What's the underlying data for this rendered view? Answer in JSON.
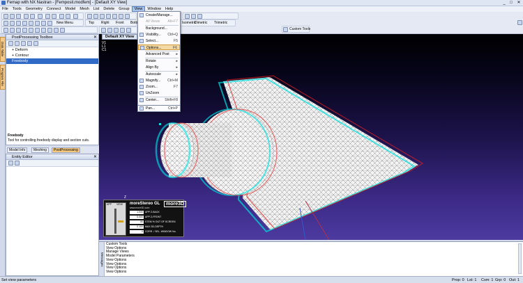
{
  "window": {
    "title": "Femap with NX Nastran - [Femposit.modfem] - [Default XY View]",
    "min": "_",
    "max": "□",
    "close": "✕"
  },
  "menubar": [
    "File",
    "Tools",
    "Geometry",
    "Connect",
    "Model",
    "Mesh",
    "List",
    "Delete",
    "Group",
    "View",
    "Window",
    "Help"
  ],
  "toolbar": {
    "new_menu": "New Menu",
    "views": [
      "Top",
      "Right",
      "Front",
      "Bottom"
    ],
    "views2": [
      "Isometric",
      "Dimetric",
      "Trimetric"
    ],
    "custom_tools": "Custom Tools"
  },
  "left_tabs": [
    "Data Table",
    "Program File"
  ],
  "pp_toolbox": {
    "title": "PostProcessing Toolbox",
    "items": [
      "Deform",
      "Contour",
      "Freebody"
    ],
    "desc_title": "Freebody",
    "desc": "Tool for controlling freebody display and section cuts."
  },
  "tabs": [
    "Model Info",
    "Meshing",
    "PostProcessing"
  ],
  "entity_editor": {
    "title": "Entity Editor"
  },
  "view": {
    "tab": "Default XY View",
    "info": [
      "V1",
      "L1",
      "C1"
    ],
    "axis_label": "Z"
  },
  "view_menu": {
    "items": [
      {
        "label": "Create/Manage...",
        "sc": "",
        "dis": false
      },
      {
        "label": "All Views",
        "sc": "Alt+F7",
        "dis": true
      },
      {
        "label": "Background...",
        "sc": "",
        "dis": false
      },
      {
        "label": "Visibility...",
        "sc": "Ctrl+Q",
        "dis": false
      },
      {
        "label": "Select...",
        "sc": "F5",
        "dis": false
      },
      {
        "label": "Options...",
        "sc": "F6",
        "dis": false
      },
      {
        "label": "Advanced Post",
        "sc": "▸",
        "dis": false
      },
      {
        "label": "Rotate",
        "sc": "▸",
        "dis": false
      },
      {
        "label": "Align By",
        "sc": "▸",
        "dis": false
      },
      {
        "label": "Autoscale",
        "sc": "▸",
        "dis": false
      },
      {
        "label": "Magnify...",
        "sc": "Ctrl+M",
        "dis": false
      },
      {
        "label": "Zoom...",
        "sc": "F7",
        "dis": false
      },
      {
        "label": "UnZoom",
        "sc": "",
        "dis": false
      },
      {
        "label": "Center...",
        "sc": "Shift+F8",
        "dis": false
      },
      {
        "label": "Pan...",
        "sc": "Ctrl+P",
        "dis": false
      }
    ],
    "highlighted_index": 5
  },
  "stereo": {
    "brand": "moreStereo GL",
    "logo": "more3D",
    "url": "www.more3D.com",
    "gauge_top": "APP",
    "gauge_top2": "VIEW",
    "rows": [
      {
        "v": "1.000",
        "l": "APP Z-BACK"
      },
      {
        "v": "0.000",
        "l": "APP Z-FRONT"
      },
      {
        "v": "50",
        "l": "STEM % OUT OF SCREEN"
      },
      {
        "v": "0.100",
        "l": "MAX 3D-DEPTH"
      },
      {
        "v": "0",
        "l": "CORR. / SEL. WINDOW No."
      }
    ]
  },
  "custom_tools": {
    "gutter": "Messages",
    "lines": [
      "Custom Tools",
      "View Options",
      "Manage Views",
      "Model Parameters",
      "View Options",
      "View Options",
      "View Options",
      "View Options",
      "View Options"
    ]
  },
  "status": {
    "left": "Set view parameters",
    "items": [
      "Prop: 0",
      "Lst: 1",
      "Csm: 1",
      "Grp: 0",
      "Out: 1"
    ]
  }
}
